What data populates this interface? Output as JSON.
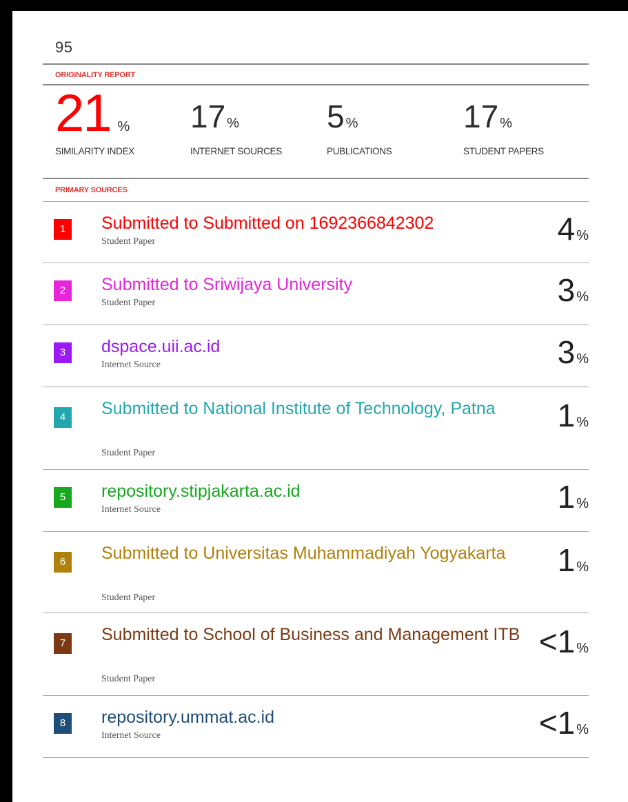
{
  "document": {
    "number": "95"
  },
  "originality_report": {
    "label": "ORIGINALITY REPORT",
    "stats": [
      {
        "value": "21",
        "unit": "%",
        "label": "SIMILARITY INDEX"
      },
      {
        "value": "17",
        "unit": "%",
        "label": "INTERNET SOURCES"
      },
      {
        "value": "5",
        "unit": "%",
        "label": "PUBLICATIONS"
      },
      {
        "value": "17",
        "unit": "%",
        "label": "STUDENT PAPERS"
      }
    ]
  },
  "primary_sources": {
    "label": "PRIMARY SOURCES",
    "items": [
      {
        "rank": "1",
        "title": "Submitted to Submitted on 1692366842302",
        "type": "Student Paper",
        "value": "4",
        "unit": "%",
        "color": "#ff0000"
      },
      {
        "rank": "2",
        "title": "Submitted to Sriwijaya University",
        "type": "Student Paper",
        "value": "3",
        "unit": "%",
        "color": "#e626d8"
      },
      {
        "rank": "3",
        "title": "dspace.uii.ac.id",
        "type": "Internet Source",
        "value": "3",
        "unit": "%",
        "color": "#9b19f5"
      },
      {
        "rank": "4",
        "title": "Submitted to National Institute of Technology, Patna",
        "type": "Student Paper",
        "value": "1",
        "unit": "%",
        "color": "#22a7ae"
      },
      {
        "rank": "5",
        "title": "repository.stipjakarta.ac.id",
        "type": "Internet Source",
        "value": "1",
        "unit": "%",
        "color": "#17a81f"
      },
      {
        "rank": "6",
        "title": "Submitted to Universitas Muhammadiyah Yogyakarta",
        "type": "Student Paper",
        "value": "1",
        "unit": "%",
        "color": "#b0800c"
      },
      {
        "rank": "7",
        "title": "Submitted to School of Business and Management ITB",
        "type": "Student Paper",
        "value": "<1",
        "unit": "%",
        "color": "#7b3a14"
      },
      {
        "rank": "8",
        "title": "repository.ummat.ac.id",
        "type": "Internet Source",
        "value": "<1",
        "unit": "%",
        "color": "#1f4e79"
      }
    ]
  }
}
